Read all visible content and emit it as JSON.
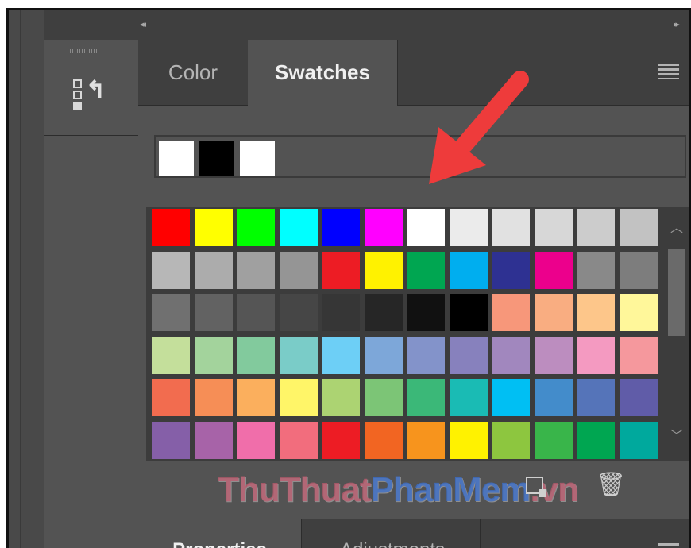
{
  "topbar": {
    "collapse_left": "◂◂",
    "collapse_right": "▸▸"
  },
  "panel": {
    "tabs": [
      {
        "label": "Color",
        "active": false
      },
      {
        "label": "Swatches",
        "active": true
      }
    ],
    "recent_swatches": [
      "#ffffff",
      "#000000",
      "#ffffff"
    ],
    "swatches": [
      [
        "#ff0000",
        "#ffff00",
        "#00ff00",
        "#00ffff",
        "#0000ff",
        "#ff00ff",
        "#ffffff",
        "#ebebeb",
        "#e1e1e1",
        "#d7d7d7",
        "#cccccc",
        "#c2c2c2"
      ],
      [
        "#b7b7b7",
        "#acacac",
        "#a0a0a0",
        "#959595",
        "#ed1c24",
        "#fff200",
        "#00a651",
        "#00aeef",
        "#2e3192",
        "#ec008c",
        "#898989",
        "#7d7d7d"
      ],
      [
        "#707070",
        "#626262",
        "#555555",
        "#464646",
        "#363636",
        "#262626",
        "#111111",
        "#000000",
        "#f7977a",
        "#f9ad81",
        "#fdc68a",
        "#fff79a"
      ],
      [
        "#c4df9b",
        "#a3d39c",
        "#82ca9d",
        "#7accc8",
        "#6dcff6",
        "#7da7d9",
        "#8393ca",
        "#8781bd",
        "#a187be",
        "#bc8dbf",
        "#f49ac1",
        "#f5989d"
      ],
      [
        "#f26c4f",
        "#f68e56",
        "#fbaf5d",
        "#fff568",
        "#acd372",
        "#7cc576",
        "#3bb878",
        "#1abbb4",
        "#00bff3",
        "#438ccb",
        "#5574b9",
        "#605ca8"
      ],
      [
        "#855fa8",
        "#a763a8",
        "#f06eaa",
        "#f26d7d",
        "#ed1c24",
        "#f26522",
        "#f7941d",
        "#fff200",
        "#8dc63f",
        "#39b54a",
        "#00a651",
        "#00a99d"
      ]
    ],
    "watermark": {
      "part1": "ThuThuat",
      "part2": "PhanMem",
      "part3": ".vn"
    }
  },
  "bottom_panel": {
    "tabs": [
      {
        "label": "Properties",
        "active": true
      },
      {
        "label": "Adjustments",
        "active": false
      }
    ]
  },
  "colors": {
    "annotation_arrow": "#ee3b3b",
    "panel_bg": "#535353",
    "header_bg": "#3f3f3f"
  }
}
